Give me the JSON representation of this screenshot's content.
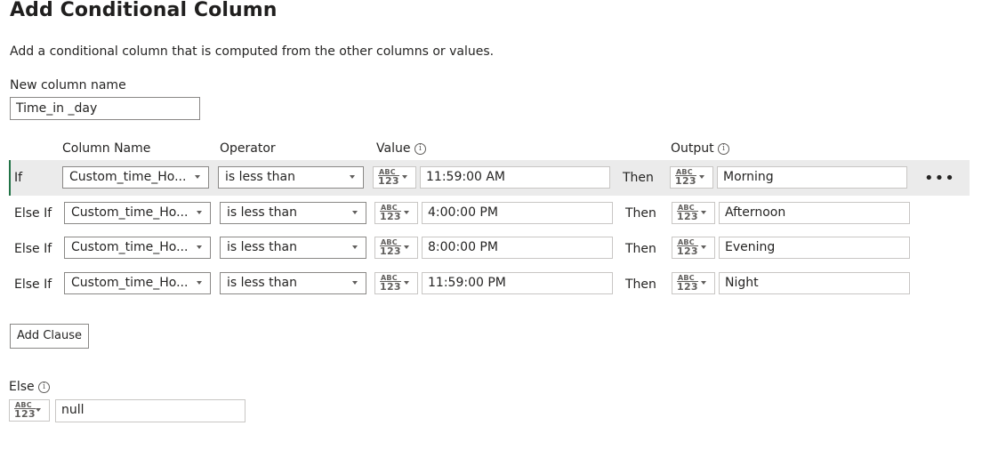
{
  "dialog": {
    "title": "Add Conditional Column",
    "description": "Add a conditional column that is computed from the other columns or values.",
    "new_column_label": "New column name",
    "new_column_value": "Time_in _day"
  },
  "headers": {
    "column_name": "Column Name",
    "operator": "Operator",
    "value": "Value",
    "output": "Output"
  },
  "type_icon": {
    "abc": "ABC",
    "num": "123"
  },
  "clauses": [
    {
      "keyword": "If",
      "column": "Custom_time_Ho...",
      "operator": "is less than",
      "value": "11:59:00 AM",
      "then": "Then",
      "output": "Morning"
    },
    {
      "keyword": "Else If",
      "column": "Custom_time_Ho...",
      "operator": "is less than",
      "value": "4:00:00 PM",
      "then": "Then",
      "output": "Afternoon"
    },
    {
      "keyword": "Else If",
      "column": "Custom_time_Ho...",
      "operator": "is less than",
      "value": "8:00:00 PM",
      "then": "Then",
      "output": "Evening"
    },
    {
      "keyword": "Else If",
      "column": "Custom_time_Ho...",
      "operator": "is less than",
      "value": "11:59:00 PM",
      "then": "Then",
      "output": "Night"
    }
  ],
  "more_glyph": "•••",
  "info_glyph": "i",
  "add_clause_label": "Add Clause",
  "else": {
    "label": "Else",
    "value": "null"
  },
  "colors": {
    "accent": "#217346",
    "selected_row": "#ebebeb",
    "border": "#8a8886"
  }
}
